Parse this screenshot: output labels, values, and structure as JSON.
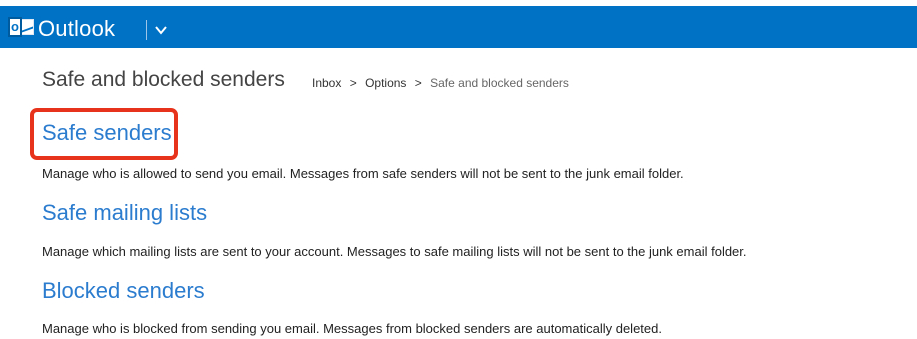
{
  "header": {
    "app_title": "Outlook",
    "logo_letter": "o",
    "background": "#0072c6",
    "menu_icon": "chevron-down-icon"
  },
  "page": {
    "title": "Safe and blocked senders"
  },
  "breadcrumb": {
    "items": [
      "Inbox",
      "Options",
      "Safe and blocked senders"
    ],
    "separator": ">"
  },
  "sections": [
    {
      "title": "Safe senders",
      "description": "Manage who is allowed to send you email. Messages from safe senders will not be sent to the junk email folder."
    },
    {
      "title": "Safe mailing lists",
      "description": "Manage which mailing lists are sent to your account. Messages to safe mailing lists will not be sent to the junk email folder."
    },
    {
      "title": "Blocked senders",
      "description": "Manage who is blocked from sending you email. Messages from blocked senders are automatically deleted."
    }
  ],
  "annotation": {
    "highlight_color": "#e8331c",
    "highlighted_item": "Safe senders"
  }
}
